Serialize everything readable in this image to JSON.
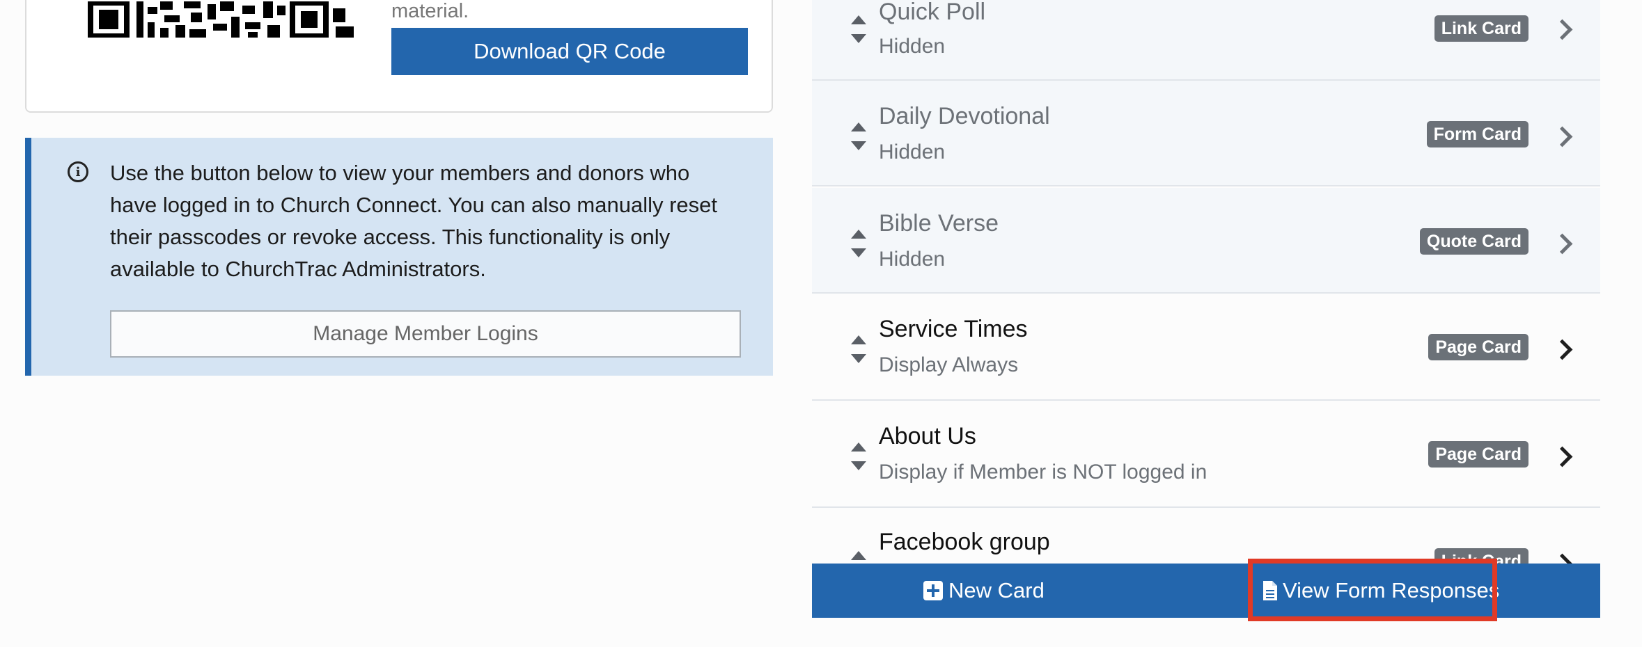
{
  "qr_panel": {
    "caption_fragment": "material.",
    "download_label": "Download QR Code"
  },
  "info_panel": {
    "message": "Use the button below to view your members and donors who have logged in to Church Connect. You can also manually reset their passcodes or revoke access. This functionality is only available to ChurchTrac Administrators.",
    "manage_label": "Manage Member Logins"
  },
  "cards": [
    {
      "title": "Quick Poll",
      "status": "Hidden",
      "type": "Link Card",
      "hidden": true
    },
    {
      "title": "Daily Devotional",
      "status": "Hidden",
      "type": "Form Card",
      "hidden": true
    },
    {
      "title": "Bible Verse",
      "status": "Hidden",
      "type": "Quote Card",
      "hidden": true
    },
    {
      "title": "Service Times",
      "status": "Display Always",
      "type": "Page Card",
      "hidden": false
    },
    {
      "title": "About Us",
      "status": "Display if Member is NOT logged in",
      "type": "Page Card",
      "hidden": false
    },
    {
      "title": "Facebook group",
      "status": "",
      "type": "Link Card",
      "hidden": false
    }
  ],
  "actions": {
    "new_card_label": "New Card",
    "view_responses_label": "View Form Responses"
  },
  "colors": {
    "primary": "#2366ad",
    "info_background": "#d5e4f3",
    "badge": "#6b7178",
    "highlight": "#e03a26"
  },
  "icons": {
    "info": "info-circle-icon",
    "sort": "sort-handle-icon",
    "chevron": "chevron-right-icon",
    "new": "plus-square-icon",
    "responses": "document-icon"
  }
}
